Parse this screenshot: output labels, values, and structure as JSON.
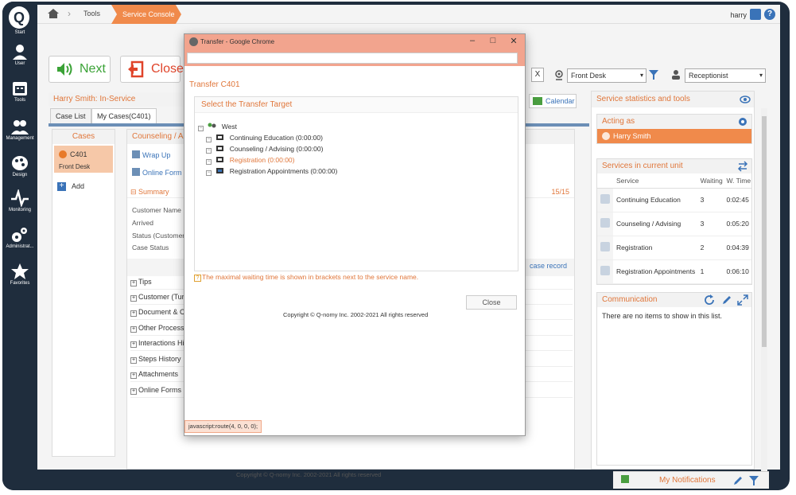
{
  "sidebar": {
    "logo": "Q",
    "items": [
      {
        "label": "Start"
      },
      {
        "label": "User"
      },
      {
        "label": "Tools"
      },
      {
        "label": "Management"
      },
      {
        "label": "Design"
      },
      {
        "label": "Monitoring"
      },
      {
        "label": "Administrat..."
      },
      {
        "label": "Favorites"
      }
    ]
  },
  "topbar": {
    "crumb_tools": "Tools",
    "crumb_active": "Service Console",
    "user_name": "harry",
    "help": "?"
  },
  "toolbar": {
    "next_label": "Next",
    "close_label": "Close",
    "x_label": "X",
    "front_desk": "Front Desk",
    "receptionist": "Receptionist",
    "calendar_label": "Calendar"
  },
  "left": {
    "header": "Harry Smith: In-Service",
    "tabs": [
      "Case List",
      "My Cases(C401)"
    ],
    "cases_title": "Cases",
    "case_number": "C401",
    "case_location": "Front Desk",
    "add_label": "Add"
  },
  "consult": {
    "title": "Counseling / Ad",
    "wrap_up": "Wrap Up",
    "online_form": "Online Form",
    "summary": "Summary",
    "count": "15/15",
    "fields": [
      "Customer Name",
      "Arrived",
      "Status (Customer",
      "Case Status"
    ],
    "case_record": "case record",
    "sections": [
      "Tips",
      "Customer (Turn",
      "Document & Cla",
      "Other Processes",
      "Interactions Hist",
      "Steps History",
      "Attachments",
      "Online Forms"
    ]
  },
  "right": {
    "title": "Service statistics and tools",
    "acting_as_title": "Acting as",
    "acting_as_name": "Harry Smith",
    "services_title": "Services in current unit",
    "columns": [
      "Service",
      "Waiting",
      "W. Time"
    ],
    "rows": [
      {
        "service": "Continuing Education",
        "waiting": "3",
        "wtime": "0:02:45"
      },
      {
        "service": "Counseling / Advising",
        "waiting": "3",
        "wtime": "0:05:20"
      },
      {
        "service": "Registration",
        "waiting": "2",
        "wtime": "0:04:39"
      },
      {
        "service": "Registration Appointments",
        "waiting": "1",
        "wtime": "0:06:10"
      }
    ],
    "comm_title": "Communication",
    "comm_empty": "There are no items to show in this list."
  },
  "footer": {
    "copyright": "Copyright © Q-nomy Inc. 2002-2021 All rights reserved",
    "notifications": "My Notifications"
  },
  "modal": {
    "window_title": "Transfer - Google Chrome",
    "heading": "Transfer C401",
    "target_title": "Select the Transfer Target",
    "tree_root": "West",
    "tree_items": [
      "Continuing Education (0:00:00)",
      "Counseling / Advising (0:00:00)",
      "Registration (0:00:00)",
      "Registration Appointments (0:00:00)"
    ],
    "note": "The maximal waiting time is shown in brackets next to the service name.",
    "close_label": "Close",
    "copyright": "Copyright © Q-nomy Inc. 2002-2021 All rights reserved",
    "status": "javascript:route(4, 0, 0, 0);"
  },
  "colors": {
    "accent": "#f08a4b",
    "sidebar": "#1f2d3d",
    "link": "#3a73b8",
    "modal_titlebar": "#f2a48e"
  }
}
